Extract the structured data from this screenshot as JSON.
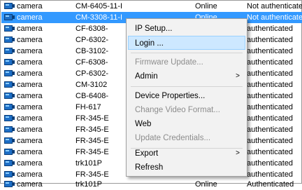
{
  "rows": [
    {
      "type": "camera",
      "model": "CM-6405-11-I",
      "status": "Online",
      "auth": "Not authenticated"
    },
    {
      "type": "camera",
      "model": "CM-3308-11-I",
      "status": "Online",
      "auth": "Not authenticated"
    },
    {
      "type": "camera",
      "model": "CF-6308-",
      "status": "",
      "auth": "authenticated"
    },
    {
      "type": "camera",
      "model": "CP-6302-",
      "status": "",
      "auth": "authenticated"
    },
    {
      "type": "camera",
      "model": "CB-3102-",
      "status": "",
      "auth": "authenticated"
    },
    {
      "type": "camera",
      "model": "CF-6308-",
      "status": "",
      "auth": "authenticated"
    },
    {
      "type": "camera",
      "model": "CP-6302-",
      "status": "",
      "auth": "authenticated"
    },
    {
      "type": "camera",
      "model": "CM-3102",
      "status": "",
      "auth": "authenticated"
    },
    {
      "type": "camera",
      "model": "CB-6408-",
      "status": "",
      "auth": "authenticated"
    },
    {
      "type": "camera",
      "model": "FH-617",
      "status": "",
      "auth": "authenticated"
    },
    {
      "type": "camera",
      "model": "FR-345-E",
      "status": "",
      "auth": "authenticated"
    },
    {
      "type": "camera",
      "model": "FR-345-E",
      "status": "",
      "auth": "authenticated"
    },
    {
      "type": "camera",
      "model": "FR-345-E",
      "status": "",
      "auth": "authenticated"
    },
    {
      "type": "camera",
      "model": "FR-345-E",
      "status": "",
      "auth": "authenticated"
    },
    {
      "type": "camera",
      "model": "trk101P",
      "status": "",
      "auth": "authenticated"
    },
    {
      "type": "camera",
      "model": "FR-345-E",
      "status": "",
      "auth": "authenticated"
    },
    {
      "type": "camera",
      "model": "trk101P",
      "status": "Online",
      "auth": "Authenticated"
    }
  ],
  "selected_index": 1,
  "context_menu": {
    "ip_setup": "IP Setup...",
    "login": "Login ...",
    "firmware_update": "Firmware Update...",
    "admin": "Admin",
    "device_properties": "Device Properties...",
    "change_video_format": "Change Video Format...",
    "web": "Web",
    "update_credentials": "Update Credentials...",
    "export": "Export",
    "refresh": "Refresh",
    "submenu_arrow": ">"
  }
}
